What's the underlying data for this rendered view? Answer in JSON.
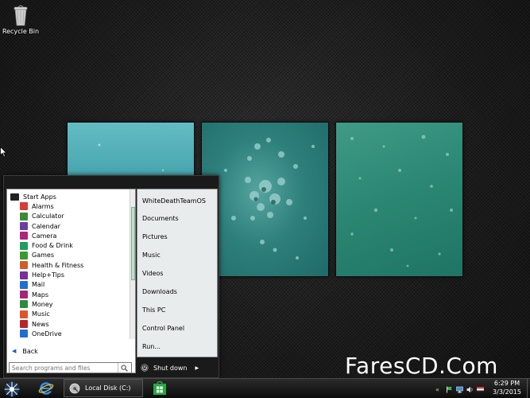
{
  "desktop": {
    "recycle_bin_label": "Recycle Bin",
    "watermark": "FaresCD.Com"
  },
  "start_menu": {
    "apps": [
      {
        "label": "Start Apps",
        "icon": "folder-icon",
        "color": "#222222",
        "folder": true
      },
      {
        "label": "Alarms",
        "icon": "alarm-icon",
        "color": "#d83b3b"
      },
      {
        "label": "Calculator",
        "icon": "calculator-icon",
        "color": "#3a8a3a"
      },
      {
        "label": "Calendar",
        "icon": "calendar-icon",
        "color": "#6b3fa0"
      },
      {
        "label": "Camera",
        "icon": "camera-icon",
        "color": "#b0237f"
      },
      {
        "label": "Food & Drink",
        "icon": "food-icon",
        "color": "#1e9d5e"
      },
      {
        "label": "Games",
        "icon": "games-icon",
        "color": "#3b9a2d"
      },
      {
        "label": "Health & Fitness",
        "icon": "health-icon",
        "color": "#d25b28"
      },
      {
        "label": "Help+Tips",
        "icon": "help-icon",
        "color": "#7a2f9b"
      },
      {
        "label": "Mail",
        "icon": "mail-icon",
        "color": "#1e6fd0"
      },
      {
        "label": "Maps",
        "icon": "maps-icon",
        "color": "#a6247a"
      },
      {
        "label": "Money",
        "icon": "money-icon",
        "color": "#2d8a3f"
      },
      {
        "label": "Music",
        "icon": "music-icon",
        "color": "#e0542a"
      },
      {
        "label": "News",
        "icon": "news-icon",
        "color": "#b7242a"
      },
      {
        "label": "OneDrive",
        "icon": "onedrive-icon",
        "color": "#1f6fd1"
      }
    ],
    "back_label": "Back",
    "search_placeholder": "Search programs and files",
    "places": [
      "WhiteDeathTeamOS",
      "Documents",
      "Pictures",
      "Music",
      "Videos",
      "Downloads",
      "This PC",
      "Control Panel",
      "Run..."
    ],
    "shutdown_label": "Shut down"
  },
  "taskbar": {
    "local_disk_label": "Local Disk (C:)",
    "tray_chevron": "«",
    "clock_time": "6:29 PM",
    "clock_date": "3/3/2015"
  },
  "colors": {
    "taskbar_bg": "#111111",
    "menu_frame": "#1a1a1a",
    "accent_green": "#6fbf8f"
  }
}
